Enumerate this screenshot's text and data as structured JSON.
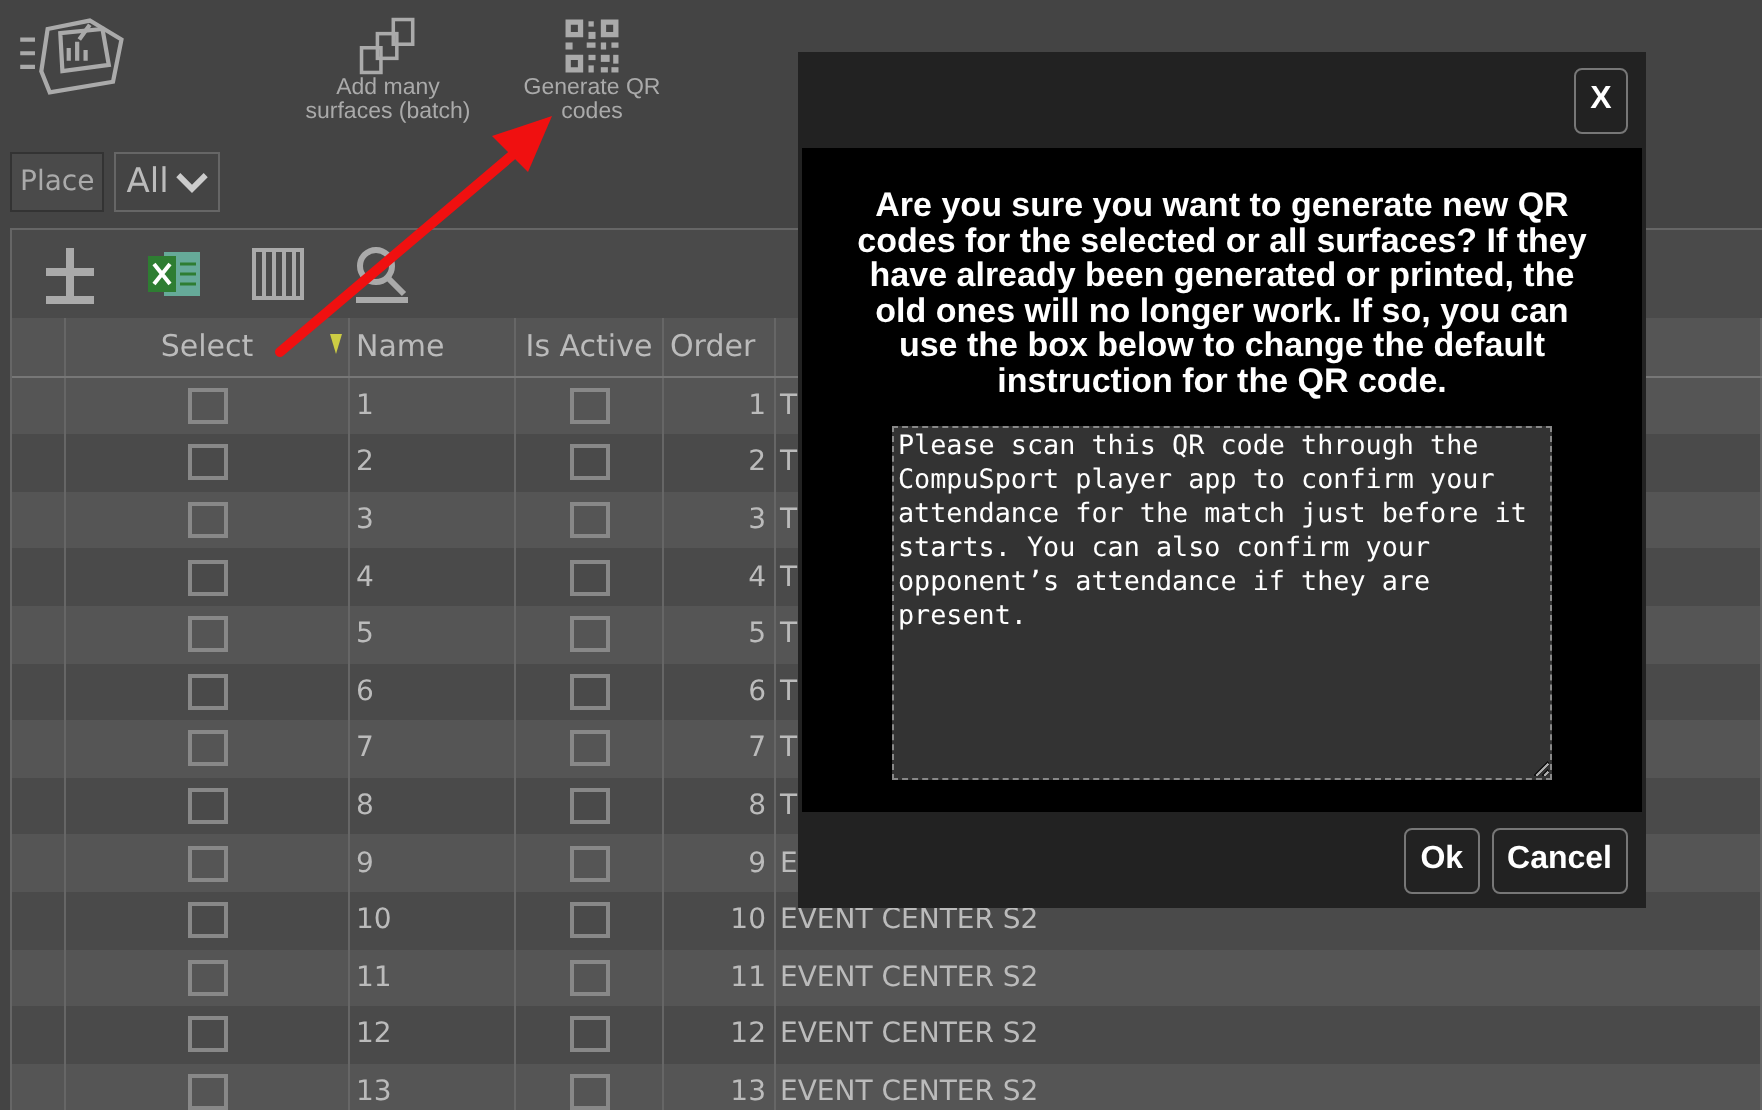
{
  "toolbar": {
    "actions": [
      {
        "kind": "batch",
        "label": "Add many surfaces (batch)"
      },
      {
        "kind": "qr",
        "label": "Generate QR codes"
      }
    ]
  },
  "filter": {
    "label": "Place",
    "value": "All"
  },
  "grid_tools": [
    {
      "kind": "add"
    },
    {
      "kind": "excel"
    },
    {
      "kind": "columns"
    },
    {
      "kind": "search"
    }
  ],
  "table": {
    "columns": [
      "Select",
      "Name",
      "Is Active",
      "Order"
    ],
    "rows": [
      {
        "select": false,
        "name": "1",
        "active": false,
        "order": "1",
        "column_5": "T"
      },
      {
        "select": false,
        "name": "2",
        "active": false,
        "order": "2",
        "column_5": "T"
      },
      {
        "select": false,
        "name": "3",
        "active": false,
        "order": "3",
        "column_5": "T"
      },
      {
        "select": false,
        "name": "4",
        "active": false,
        "order": "4",
        "column_5": "T"
      },
      {
        "select": false,
        "name": "5",
        "active": false,
        "order": "5",
        "column_5": "T"
      },
      {
        "select": false,
        "name": "6",
        "active": false,
        "order": "6",
        "column_5": "T"
      },
      {
        "select": false,
        "name": "7",
        "active": false,
        "order": "7",
        "column_5": "T"
      },
      {
        "select": false,
        "name": "8",
        "active": false,
        "order": "8",
        "column_5": "T"
      },
      {
        "select": false,
        "name": "9",
        "active": false,
        "order": "9",
        "column_5": "E"
      },
      {
        "select": false,
        "name": "10",
        "active": false,
        "order": "10",
        "column_5": "EVENT CENTER S2"
      },
      {
        "select": false,
        "name": "11",
        "active": false,
        "order": "11",
        "column_5": "EVENT CENTER S2"
      },
      {
        "select": false,
        "name": "12",
        "active": false,
        "order": "12",
        "column_5": "EVENT CENTER S2"
      },
      {
        "select": false,
        "name": "13",
        "active": false,
        "order": "13",
        "column_5": "EVENT CENTER S2"
      }
    ]
  },
  "dialog": {
    "close": "X",
    "message": "Are you sure you want to generate new QR codes for the selected or all surfaces? If they have already been generated or printed, the old ones will no longer work. If so, you can use the box below to change the default instruction for the QR code.",
    "instruction": "Please scan this QR code through the CompuSport player app to confirm your attendance for the match just before it starts. You can also confirm your opponent’s attendance if they are present.",
    "buttons": [
      "Ok",
      "Cancel"
    ]
  }
}
